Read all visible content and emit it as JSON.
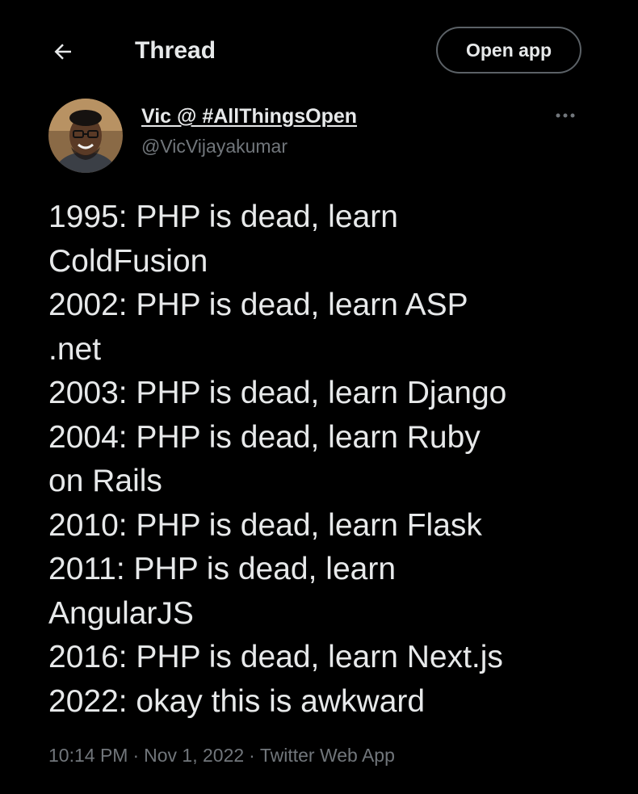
{
  "header": {
    "title": "Thread",
    "back_icon": "arrow-left-icon",
    "open_app_label": "Open app"
  },
  "author": {
    "display_name": "Vic @ #AllThingsOpen",
    "handle": "@VicVijayakumar",
    "avatar_icon": "avatar-photo",
    "more_icon": "more-horizontal-icon"
  },
  "tweet": {
    "lines": [
      "1995: PHP is dead, learn",
      "ColdFusion",
      "2002: PHP is dead, learn ASP",
      ".net",
      "2003: PHP is dead, learn Django",
      "2004: PHP is dead, learn Ruby",
      "on Rails",
      "2010: PHP is dead, learn Flask",
      "2011: PHP is dead, learn",
      "AngularJS",
      "2016: PHP is dead, learn Next.js",
      "2022: okay this is awkward"
    ]
  },
  "meta": {
    "time": "10:14 PM",
    "date": "Nov 1, 2022",
    "source": "Twitter Web App",
    "separator": "·"
  },
  "colors": {
    "background": "#000000",
    "text": "#e7e9ea",
    "secondary": "#71767b",
    "border": "#5b6166"
  }
}
